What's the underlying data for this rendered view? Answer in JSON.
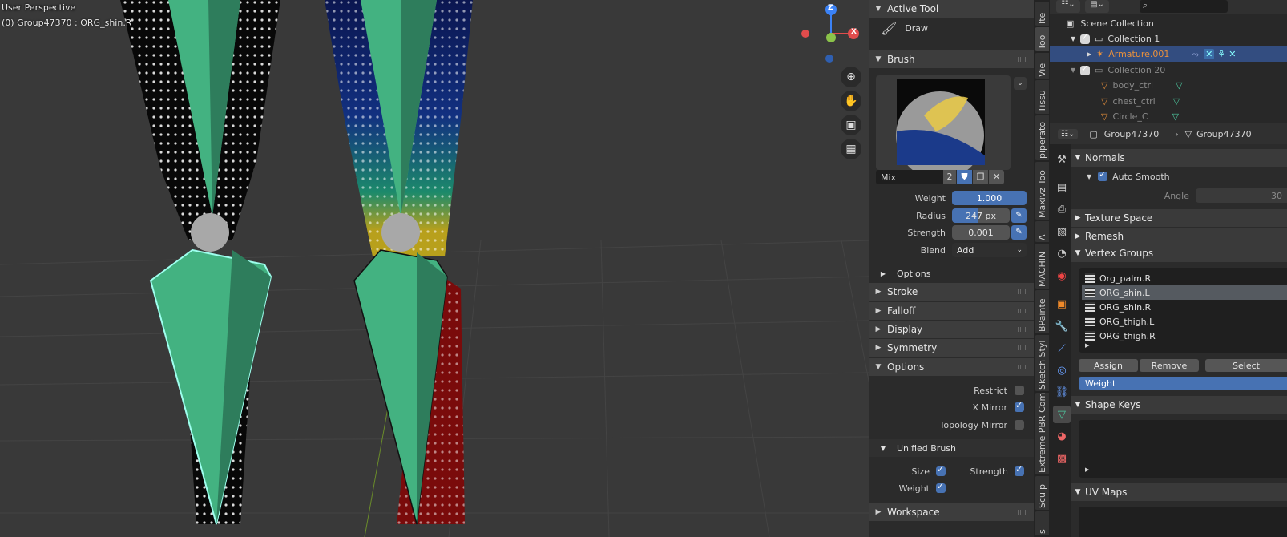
{
  "viewport": {
    "perspective_label": "User Perspective",
    "object_label": "(0) Group47370 : ORG_shin.R",
    "gizmo": {
      "z": "Z",
      "x": "X"
    },
    "nav_icons": [
      "zoom-icon",
      "hand-icon",
      "camera-icon",
      "grid-icon"
    ]
  },
  "tool_panel": {
    "active_tool_header": "Active Tool",
    "active_tool_name": "Draw",
    "brush_header": "Brush",
    "brush_name": "Mix",
    "brush_users": "2",
    "weight_label": "Weight",
    "weight_value": "1.000",
    "radius_label": "Radius",
    "radius_value": "247 px",
    "strength_label": "Strength",
    "strength_value": "0.001",
    "blend_label": "Blend",
    "blend_value": "Add",
    "brush_options_label": "Options",
    "collapsed_sections": [
      "Stroke",
      "Falloff",
      "Display",
      "Symmetry"
    ],
    "options_header": "Options",
    "restrict_label": "Restrict",
    "restrict_checked": false,
    "xmirror_label": "X Mirror",
    "xmirror_checked": true,
    "topology_label": "Topology Mirror",
    "topology_checked": false,
    "unified_header": "Unified Brush",
    "unified_size_label": "Size",
    "unified_strength_label": "Strength",
    "unified_weight_label": "Weight",
    "workspace_header": "Workspace"
  },
  "side_tabs": [
    "Ite",
    "Too",
    "Vie",
    "Tissu",
    "piperato",
    "Maxivz Too",
    "A",
    "MACHIN",
    "BPainte",
    "Sketch Styl",
    "Extreme PBR Com",
    "Sculp",
    "s"
  ],
  "outliner": {
    "rows": [
      {
        "label": "Scene Collection"
      },
      {
        "label": "Collection 1"
      },
      {
        "label": "Armature.001"
      },
      {
        "label": "Collection 20"
      },
      {
        "label": "body_ctrl"
      },
      {
        "label": "chest_ctrl"
      },
      {
        "label": "Circle_C"
      }
    ]
  },
  "properties": {
    "breadcrumb_object": "Group47370",
    "breadcrumb_data": "Group47370",
    "normals_header": "Normals",
    "auto_smooth_label": "Auto Smooth",
    "angle_label": "Angle",
    "angle_value": "30",
    "texture_space_header": "Texture Space",
    "remesh_header": "Remesh",
    "vertex_groups_header": "Vertex Groups",
    "vertex_groups": [
      "Org_palm.R",
      "ORG_shin.L",
      "ORG_shin.R",
      "ORG_thigh.L",
      "ORG_thigh.R"
    ],
    "selected_group": "ORG_shin.L",
    "assign_label": "Assign",
    "remove_label": "Remove",
    "select_label": "Select",
    "weight_field_label": "Weight",
    "shape_keys_header": "Shape Keys",
    "uv_maps_header": "UV Maps"
  },
  "colors": {
    "accent_blue": "#4772b3",
    "bone_green": "#43b281",
    "armature_orange": "#e8903c"
  }
}
